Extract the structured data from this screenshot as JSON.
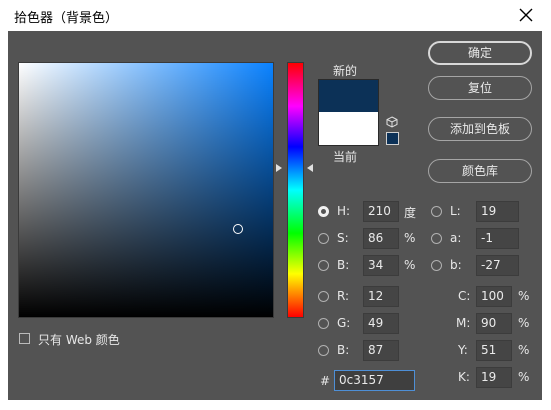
{
  "window": {
    "title": "拾色器（背景色）"
  },
  "preview": {
    "new_label": "新的",
    "current_label": "当前",
    "new_color": "#0c3157",
    "current_color": "#ffffff"
  },
  "buttons": {
    "ok": "确定",
    "reset": "复位",
    "add_to_swatches": "添加到色板",
    "color_libraries": "颜色库"
  },
  "hsb": {
    "h": {
      "label": "H:",
      "value": "210",
      "unit": "度",
      "selected": true
    },
    "s": {
      "label": "S:",
      "value": "86",
      "unit": "%"
    },
    "b": {
      "label": "B:",
      "value": "34",
      "unit": "%"
    }
  },
  "lab": {
    "l": {
      "label": "L:",
      "value": "19"
    },
    "a": {
      "label": "a:",
      "value": "-1"
    },
    "b": {
      "label": "b:",
      "value": "-27"
    }
  },
  "rgb": {
    "r": {
      "label": "R:",
      "value": "12"
    },
    "g": {
      "label": "G:",
      "value": "49"
    },
    "b": {
      "label": "B:",
      "value": "87"
    }
  },
  "cmyk": {
    "c": {
      "label": "C:",
      "value": "100",
      "unit": "%"
    },
    "m": {
      "label": "M:",
      "value": "90",
      "unit": "%"
    },
    "y": {
      "label": "Y:",
      "value": "51",
      "unit": "%"
    },
    "k": {
      "label": "K:",
      "value": "19",
      "unit": "%"
    }
  },
  "hex": {
    "label": "#",
    "value": "0c3157"
  },
  "web_only": {
    "label": "只有 Web 颜色",
    "checked": false
  },
  "icons": {
    "close": "close-icon",
    "cube": "web-safe-cube-icon"
  }
}
